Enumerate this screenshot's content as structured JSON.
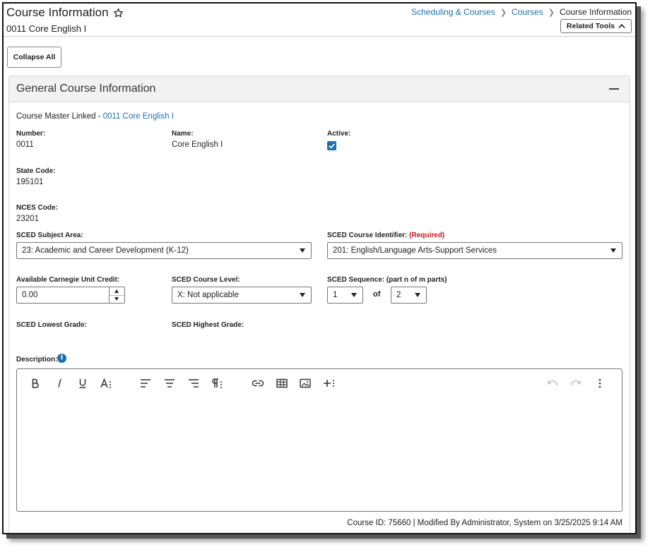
{
  "header": {
    "title": "Course Information",
    "subtitle": "0011 Core English I",
    "breadcrumb": [
      "Scheduling & Courses",
      "Courses",
      "Course Information"
    ],
    "related_tools_label": "Related Tools"
  },
  "toolbar": {
    "collapse_all_label": "Collapse All"
  },
  "panel": {
    "title": "General Course Information",
    "course_master_prefix": "Course Master Linked - ",
    "course_master_link": "0011 Core English I",
    "number_label": "Number:",
    "number_value": "0011",
    "name_label": "Name:",
    "name_value": "Core English I",
    "active_label": "Active:",
    "active_checked": true,
    "state_code_label": "State Code:",
    "state_code_value": "195101",
    "nces_code_label": "NCES Code:",
    "nces_code_value": "23201",
    "sced_subject_label": "SCED Subject Area:",
    "sced_subject_value": "23: Academic and Career Development (K-12)",
    "sced_identifier_label": "SCED Course Identifier: ",
    "sced_identifier_required": "(Required)",
    "sced_identifier_value": "201: English/Language Arts-Support Services",
    "carnegie_label": "Available Carnegie Unit Credit:",
    "carnegie_value": "0.00",
    "sced_level_label": "SCED Course Level:",
    "sced_level_value": "X: Not applicable",
    "sced_sequence_label": "SCED Sequence: (part n of m parts)",
    "sced_sequence_n": "1",
    "sced_sequence_of": "of",
    "sced_sequence_m": "2",
    "lowest_grade_label": "SCED Lowest Grade:",
    "highest_grade_label": "SCED Highest Grade:",
    "description_label": "Description:",
    "footer_meta": "Course ID: 75660 | Modified By Administrator, System on 3/25/2025 9:14 AM"
  },
  "editor_toolbar": [
    "bold-icon",
    "italic-icon",
    "underline-icon",
    "font-size-icon",
    "align-left-icon",
    "align-center-icon",
    "align-right-icon",
    "paragraph-icon",
    "link-icon",
    "table-icon",
    "image-icon",
    "insert-more-icon",
    "undo-icon",
    "redo-icon",
    "more-options-icon"
  ],
  "colors": {
    "link": "#1b6fb3",
    "required": "#c0171c",
    "checkbox": "#1b6fb3"
  }
}
